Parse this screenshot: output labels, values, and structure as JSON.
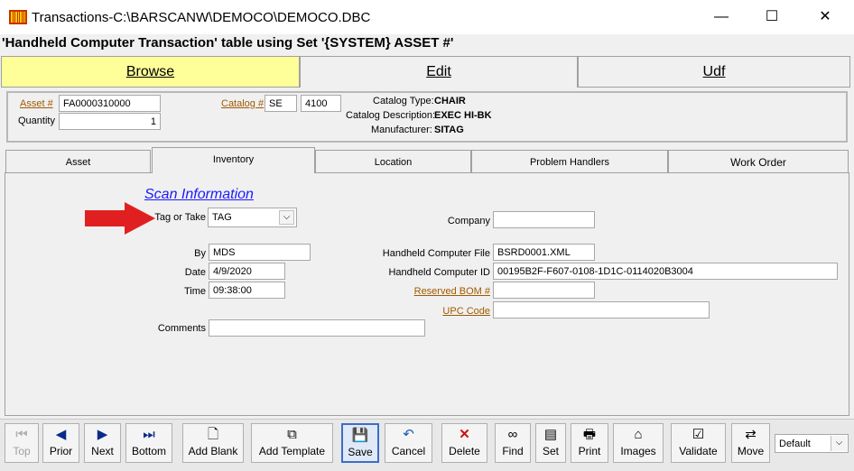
{
  "window": {
    "title": "Transactions-C:\\BARSCANW\\DEMOCO\\DEMOCO.DBC",
    "minimize_glyph": "—",
    "maximize_glyph": "☐",
    "close_glyph": "✕"
  },
  "heading": "'Handheld Computer Transaction' table using Set '{SYSTEM} ASSET #'",
  "main_tabs": [
    "Browse",
    "Edit",
    "Udf"
  ],
  "header": {
    "asset_label": "Asset #",
    "asset_value": "FA0000310000",
    "quantity_label": "Quantity",
    "quantity_value": "1",
    "catalog_label": "Catalog #",
    "catalog_prefix": "SE",
    "catalog_number": "4100",
    "catalog_type_label": "Catalog Type:",
    "catalog_type_value": "CHAIR",
    "catalog_desc_label": "Catalog Description:",
    "catalog_desc_value": "EXEC HI-BK",
    "manufacturer_label": "Manufacturer:",
    "manufacturer_value": "SITAG"
  },
  "sub_tabs": [
    "Asset",
    "Inventory",
    "Location",
    "Problem Handlers",
    "Work Order"
  ],
  "scan": {
    "section_title": "Scan Information",
    "tag_or_take_label": "Tag or Take",
    "tag_or_take_value": "TAG",
    "by_label": "By",
    "by_value": "MDS",
    "date_label": "Date",
    "date_value": "4/9/2020",
    "time_label": "Time",
    "time_value": "09:38:00",
    "comments_label": "Comments",
    "comments_value": "",
    "company_label": "Company",
    "company_value": "",
    "hc_file_label": "Handheld Computer File",
    "hc_file_value": "BSRD0001.XML",
    "hc_id_label": "Handheld Computer ID",
    "hc_id_value": "00195B2F-F607-0108-1D1C-0114020B3004",
    "reserved_bom_label": "Reserved BOM #",
    "reserved_bom_value": "",
    "upc_label": "UPC Code",
    "upc_value": ""
  },
  "toolbar": {
    "top": "Top",
    "prior": "Prior",
    "next": "Next",
    "bottom": "Bottom",
    "add_blank": "Add Blank",
    "add_template": "Add Template",
    "save": "Save",
    "cancel": "Cancel",
    "delete": "Delete",
    "find": "Find",
    "set": "Set",
    "print": "Print",
    "images": "Images",
    "validate": "Validate",
    "move": "Move",
    "set_select_value": "Default"
  },
  "colors": {
    "browse_tab": "#ffff99",
    "link": "#a05a00",
    "scan_title": "#1a1aff",
    "arrow": "#e02020"
  },
  "icons": {
    "app": "barcode-icon",
    "top": "first-record-icon",
    "prior": "prior-arrow-icon",
    "next": "next-arrow-icon",
    "bottom": "last-record-icon",
    "add_blank": "blank-page-icon",
    "add_template": "template-copy-icon",
    "save": "floppy-disk-icon",
    "cancel": "undo-icon",
    "delete": "red-x-icon",
    "find": "binoculars-icon",
    "set": "set-list-icon",
    "print": "print-icon",
    "images": "images-icon",
    "validate": "validate-icon",
    "move": "move-icon"
  }
}
